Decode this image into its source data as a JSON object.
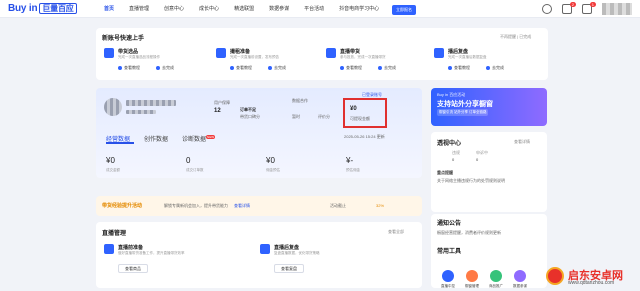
{
  "app": {
    "logo": "Buy in",
    "logo_cn": "巨量百应"
  },
  "nav": [
    "首页",
    "直播管理",
    "创意中心",
    "成长中心",
    "精选联盟",
    "数据参谋",
    "平台活动",
    "抖音电商学习中心"
  ],
  "header_badges": {
    "messages": "2",
    "notifications": "1"
  },
  "onboarding": {
    "title": "新账号快速上手",
    "more": "不再提醒 | 已完成",
    "steps": [
      {
        "title": "带货选品",
        "desc": "完成一次直播选品流程操作",
        "a1": "查看教程",
        "a2": "去完成"
      },
      {
        "title": "撮租准备",
        "desc": "完成一次直播前设置，发布预告",
        "a1": "查看教程",
        "a2": "去完成"
      },
      {
        "title": "直播带货",
        "desc": "参与投放，完成一次直播带货",
        "a1": "查看教程",
        "a2": "去完成"
      },
      {
        "title": "播后复盘",
        "desc": "完成一次直播后数据复盘",
        "a1": "查看教程",
        "a2": "去完成"
      }
    ]
  },
  "account": {
    "tag": "已登录账号",
    "label_a": "用户保障",
    "value_a": "12",
    "label_b": "订单不足",
    "value_b_sub": "带货口碑分",
    "label_c": "数据合作",
    "label_d": "暂时",
    "label_e": "评价分",
    "money": "¥0",
    "money_label": "可提现金额",
    "update_time": "2025-05-26 15:24 更新"
  },
  "tabs": [
    {
      "label": "经营数据",
      "active": true
    },
    {
      "label": "创作数据",
      "active": false
    },
    {
      "label": "诊断数据",
      "active": false,
      "badge": "NEW"
    }
  ],
  "metrics": [
    {
      "value": "¥0",
      "label": "成交金额"
    },
    {
      "value": "0",
      "label": "成交订单数"
    },
    {
      "value": "¥0",
      "label": "佣金预估"
    },
    {
      "value": "¥-",
      "label": "预估佣金"
    }
  ],
  "promo": {
    "title": "带货经验提升活动",
    "desc": "解锁专属新机会加入，提升带货能力",
    "link": "查看详情",
    "right": "活动截止",
    "pct": "32%",
    "btn": "立即报名"
  },
  "live": {
    "title": "直播管理",
    "more": "查看全部",
    "items": [
      {
        "title": "直播前准备",
        "desc": "做好直播带货准备工作，提升直播带货效率",
        "btn": "查看商品"
      },
      {
        "title": "直播后复盘",
        "desc": "复盘直播数据，优化带货策略",
        "btn": "查看复盘"
      }
    ]
  },
  "right": {
    "banner_t1": "Buy in 百应活动",
    "banner_t2": "支持站外分享橱窗",
    "banner_t3": "橱窗引流 站外分享 订单全链路",
    "transparency_title": "透视中心",
    "transparency_more": "查看详情",
    "cols": [
      "违规",
      "申诉中"
    ],
    "cols_vals": [
      "0",
      "0"
    ],
    "notice1_title": "重点提醒",
    "notice1_text": "关于网络主播违规行为的处罚规则说明",
    "notice2_title": "通知公告",
    "notice2_text": "橱窗经营提醒，消费者评价规则更新",
    "tools_title": "常用工具",
    "tools": [
      "直播中控",
      "橱窗管理",
      "商品推广",
      "数据参谋"
    ]
  },
  "watermark": {
    "cn": "启东安卓网",
    "url": "www.qdtanzhou.com"
  }
}
